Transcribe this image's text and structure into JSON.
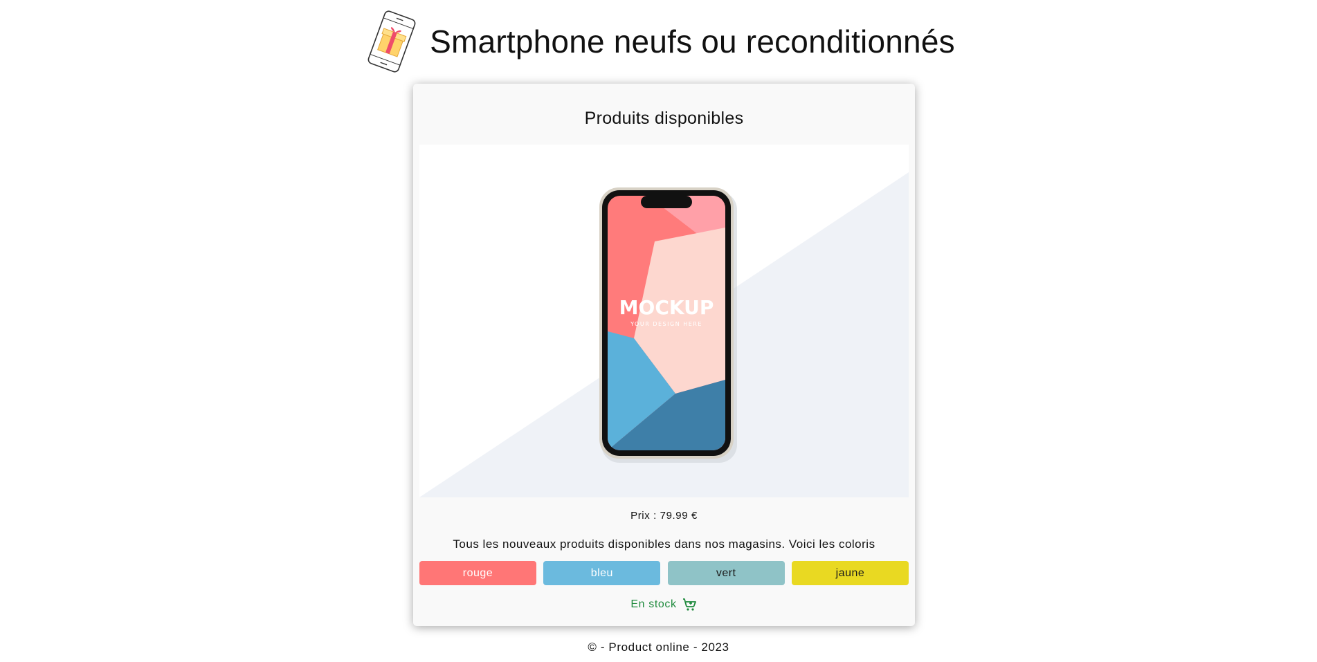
{
  "header": {
    "title": "Smartphone neufs ou reconditionnés",
    "logo_icon": "phone-gift-icon"
  },
  "card": {
    "title": "Produits disponibles",
    "image": {
      "icon": "smartphone-mockup-image",
      "mockup_text": "MOCKUP",
      "mockup_subtext": "YOUR DESIGN HERE"
    },
    "price": "Prix : 79.99 €",
    "description": "Tous les nouveaux produits disponibles dans nos magasins. Voici les coloris",
    "colors": [
      {
        "label": "rouge",
        "bg": "#ff7676",
        "fg": "#ffffff"
      },
      {
        "label": "bleu",
        "bg": "#6bbade",
        "fg": "#ffffff"
      },
      {
        "label": "vert",
        "bg": "#8fc3c7",
        "fg": "#1a1a1a"
      },
      {
        "label": "jaune",
        "bg": "#e9d922",
        "fg": "#1a1a1a"
      }
    ],
    "stock": {
      "label": "En stock",
      "color": "#1e8a3c",
      "icon": "shopping-cart-icon"
    }
  },
  "footer": {
    "text": "© - Product online - 2023"
  }
}
